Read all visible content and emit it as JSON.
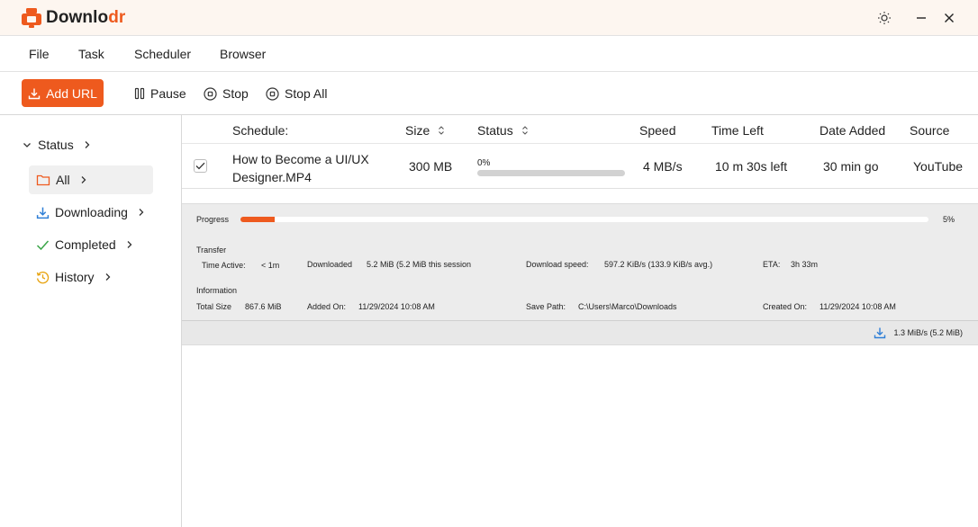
{
  "app": {
    "brand_prefix": "Downlo",
    "brand_suffix": "dr",
    "accent_color": "#ee5a1e"
  },
  "menu": [
    "File",
    "Task",
    "Scheduler",
    "Browser"
  ],
  "toolbar": {
    "add_url": "Add URL",
    "pause": "Pause",
    "stop": "Stop",
    "stop_all": "Stop All"
  },
  "sidebar": {
    "status_label": "Status",
    "items": [
      {
        "label": "All",
        "icon": "folder-icon",
        "active": true
      },
      {
        "label": "Downloading",
        "icon": "download-icon",
        "active": false
      },
      {
        "label": "Completed",
        "icon": "check-icon",
        "active": false
      },
      {
        "label": "History",
        "icon": "history-icon",
        "active": false
      }
    ]
  },
  "table": {
    "headers": {
      "schedule": "Schedule:",
      "size": "Size",
      "status": "Status",
      "speed": "Speed",
      "time_left": "Time Left",
      "date_added": "Date Added",
      "source": "Source"
    },
    "rows": [
      {
        "checked": true,
        "name_line1": "How to Become a UI/UX",
        "name_line2": "Designer.MP4",
        "size": "300 MB",
        "status_pct_text": "0%",
        "status_fraction": 0,
        "speed": "4 MB/s",
        "time_left": "10 m 30s left",
        "date_added": "30 min go",
        "source": "YouTube"
      }
    ]
  },
  "details": {
    "progress_label": "Progress",
    "progress_fraction": 0.05,
    "progress_text": "5%",
    "transfer_heading": "Transfer",
    "time_active_label": "Time Active:",
    "time_active_value": "< 1m",
    "downloaded_label": "Downloaded",
    "downloaded_value": "5.2 MiB (5.2 MiB this session",
    "download_speed_label": "Download speed:",
    "download_speed_value": "597.2 KiB/s (133.9 KiB/s avg.)",
    "eta_label": "ETA:",
    "eta_value": "3h 33m",
    "information_heading": "Information",
    "total_size_label": "Total Size",
    "total_size_value": "867.6 MiB",
    "added_on_label": "Added On:",
    "added_on_value": "11/29/2024 10:08 AM",
    "save_path_label": "Save Path:",
    "save_path_value": "C:\\Users\\Marco\\Downloads",
    "created_on_label": "Created On:",
    "created_on_value": "11/29/2024 10:08 AM"
  },
  "statusbar": {
    "rate": "1.3 MiB/s (5.2 MiB)"
  }
}
